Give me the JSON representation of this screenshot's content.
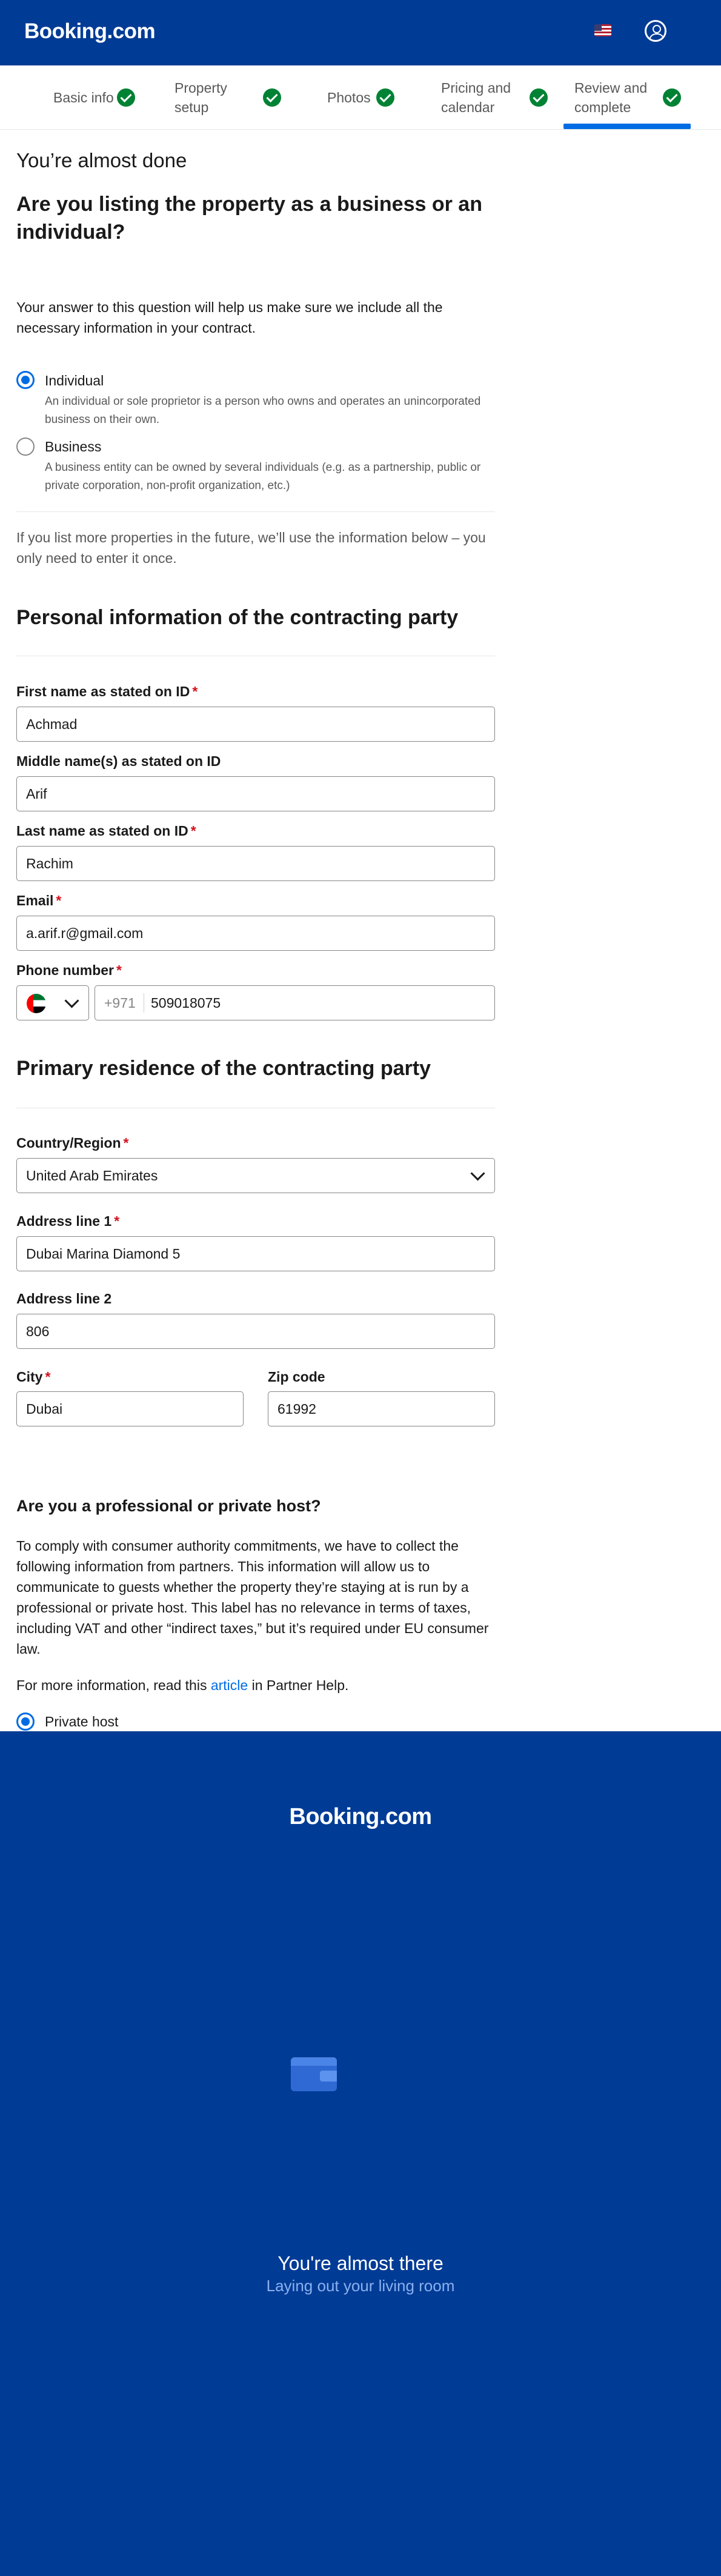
{
  "header": {
    "logo": "Booking.com"
  },
  "steps": [
    {
      "label_lines": [
        "Basic info"
      ],
      "done": true
    },
    {
      "label_lines": [
        "Property",
        "setup"
      ],
      "done": true
    },
    {
      "label_lines": [
        "Photos"
      ],
      "done": true
    },
    {
      "label_lines": [
        "Pricing and",
        "calendar"
      ],
      "done": true
    },
    {
      "label_lines": [
        "Review and",
        "complete"
      ],
      "done": true,
      "active": true
    }
  ],
  "main": {
    "almost_done": "You’re almost done",
    "business_question": "Are you listing the property as a business or an individual?",
    "business_help": "Your answer to this question will help us make sure we include all the necessary information in your contract.",
    "options": [
      {
        "label": "Individual",
        "desc": "An individual or sole proprietor is a person who owns and operates an unincorporated business on their own.",
        "selected": true
      },
      {
        "label": "Business",
        "desc": "A business entity can be owned by several individuals (e.g. as a partnership, public or private corporation, non-profit organization, etc.)",
        "selected": false
      }
    ],
    "future_note": "If you list more properties in the future, we’ll use the information below – you only need to enter it once.",
    "personal_heading": "Personal information of the contracting party",
    "first_name": {
      "label": "First name as stated on ID",
      "value": "Achmad",
      "required": "*"
    },
    "middle_name": {
      "label": "Middle name(s) as stated on ID",
      "value": "Arif"
    },
    "last_name": {
      "label": "Last name as stated on ID",
      "value": "Rachim",
      "required": "*"
    },
    "email": {
      "label": "Email",
      "value": "a.arif.r@gmail.com",
      "required": "*"
    },
    "phone": {
      "label": "Phone number",
      "required": "*",
      "country_code": "+971",
      "value": "509018075"
    },
    "residence_heading": "Primary residence of the contracting party",
    "country": {
      "label": "Country/Region",
      "value": "United Arab Emirates",
      "required": "*"
    },
    "address1": {
      "label": "Address line 1",
      "value": "Dubai Marina Diamond 5",
      "required": "*"
    },
    "address2": {
      "label": "Address line 2",
      "value": "806"
    },
    "city": {
      "label": "City",
      "value": "Dubai",
      "required": "*"
    },
    "zip": {
      "label": "Zip code",
      "value": "61992"
    },
    "host_heading": "Are you a professional or private host?",
    "host_text": "To comply with consumer authority commitments, we have to collect the following information from partners. This information will allow us to communicate to guests whether the property they’re staying at is run by a professional or private host. This label has no relevance in terms of taxes, including VAT and other “indirect taxes,” but it’s required under EU consumer law.",
    "more_info_prefix": "For more information, read this ",
    "more_info_link": "article",
    "more_info_suffix": " in Partner Help.",
    "host_option": "Private host"
  },
  "overlay": {
    "logo": "Booking.com",
    "title": "You're almost there",
    "subtitle": "Laying out your living room"
  },
  "colors": {
    "brand": "#003b95",
    "accent": "#006ce4",
    "success": "#008234",
    "required": "#d4111e"
  },
  "icons": [
    "us-flag-icon",
    "account-icon",
    "check-icon",
    "uae-flag-icon",
    "chevron-down-icon",
    "wallet-icon"
  ]
}
